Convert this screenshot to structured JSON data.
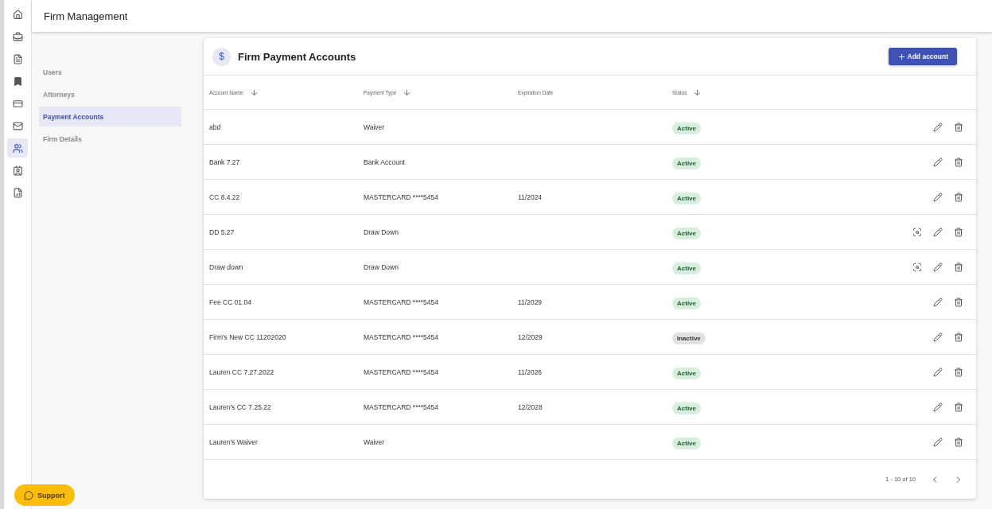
{
  "rail": [
    {
      "selected": false
    },
    {
      "selected": false
    },
    {
      "selected": false
    },
    {
      "selected": false
    },
    {
      "selected": false
    },
    {
      "selected": false
    },
    {
      "selected": true
    },
    {
      "selected": false
    },
    {
      "selected": false
    }
  ],
  "header": {
    "title": "Firm Management"
  },
  "subnav": [
    {
      "label": "Users",
      "selected": false
    },
    {
      "label": "Attorneys",
      "selected": false
    },
    {
      "label": "Payment Accounts",
      "selected": true
    },
    {
      "label": "Firm Details",
      "selected": false
    }
  ],
  "card": {
    "icon": "$",
    "title": "Firm Payment Accounts",
    "add_button": "Add account"
  },
  "table": {
    "columns": [
      {
        "label": "Account Name",
        "sortable": true
      },
      {
        "label": "Payment Type",
        "sortable": true
      },
      {
        "label": "Expiration Date",
        "sortable": false
      },
      {
        "label": "Status",
        "sortable": true
      }
    ],
    "rows": [
      {
        "name": "abd",
        "type": "Waiver",
        "expiration": "",
        "status": "Active",
        "active": true,
        "preview": false
      },
      {
        "name": "Bank 7.27",
        "type": "Bank Account",
        "expiration": "",
        "status": "Active",
        "active": true,
        "preview": false
      },
      {
        "name": "CC 8.4.22",
        "type": "MASTERCARD ****5454",
        "expiration": "11/2024",
        "status": "Active",
        "active": true,
        "preview": false
      },
      {
        "name": "DD 5.27",
        "type": "Draw Down",
        "expiration": "",
        "status": "Active",
        "active": true,
        "preview": true
      },
      {
        "name": "Draw down",
        "type": "Draw Down",
        "expiration": "",
        "status": "Active",
        "active": true,
        "preview": true
      },
      {
        "name": "Fee CC 01.04",
        "type": "MASTERCARD ****5454",
        "expiration": "11/2029",
        "status": "Active",
        "active": true,
        "preview": false
      },
      {
        "name": "Firm's New CC 11202020",
        "type": "MASTERCARD ****5454",
        "expiration": "12/2029",
        "status": "Inactive",
        "active": false,
        "preview": false
      },
      {
        "name": "Lauren CC 7.27.2022",
        "type": "MASTERCARD ****5454",
        "expiration": "11/2026",
        "status": "Active",
        "active": true,
        "preview": false
      },
      {
        "name": "Lauren's CC 7.25.22",
        "type": "MASTERCARD ****5454",
        "expiration": "12/2028",
        "status": "Active",
        "active": true,
        "preview": false
      },
      {
        "name": "Lauren's Waiver",
        "type": "Waiver",
        "expiration": "",
        "status": "Active",
        "active": true,
        "preview": false
      }
    ],
    "pagination": "1 - 10 of 10"
  },
  "support_button": "Support"
}
